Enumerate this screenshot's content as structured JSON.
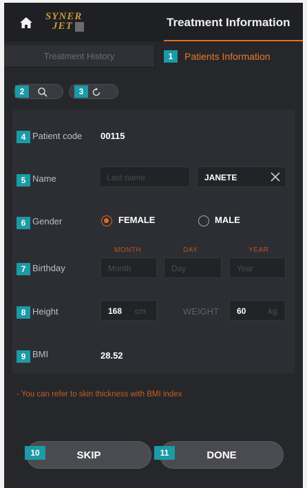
{
  "header": {
    "logo_line1": "SYNER",
    "logo_line2": "JET",
    "title": "Treatment Information",
    "home_icon": "home-icon"
  },
  "tabs": {
    "history": "Treatment History",
    "patients": "Patients Information",
    "patients_num": "1"
  },
  "toolbar": {
    "search_num": "2",
    "search_icon": "search-icon",
    "refresh_num": "3",
    "refresh_icon": "refresh-icon"
  },
  "form": {
    "patient_code": {
      "num": "4",
      "label": "Patient code",
      "value": "00115"
    },
    "name": {
      "num": "5",
      "label": "Name",
      "last_placeholder": "Last name",
      "first_value": "JANETE",
      "clear_icon": "close-icon"
    },
    "gender": {
      "num": "6",
      "label": "Gender",
      "female": "FEMALE",
      "male": "MALE",
      "selected": "FEMALE"
    },
    "birthday": {
      "num": "7",
      "label": "Birthday",
      "month_label": "MONTH",
      "day_label": "DAY",
      "year_label": "YEAR",
      "month_placeholder": "Month",
      "day_placeholder": "Day",
      "year_placeholder": "Year"
    },
    "height": {
      "num": "8",
      "label": "Height",
      "value": "168",
      "unit": "cm"
    },
    "weight": {
      "label": "WEIGHT",
      "value": "60",
      "unit": "kg"
    },
    "bmi": {
      "num": "9",
      "label": "BMI",
      "value": "28.52"
    }
  },
  "note": "- You can refer to skin thickness with BMI index",
  "buttons": {
    "skip": {
      "num": "10",
      "label": "SKIP"
    },
    "done": {
      "num": "11",
      "label": "DONE"
    }
  },
  "colors": {
    "accent": "#e86e24",
    "badge": "#1c9aa5",
    "background": "#26272b"
  }
}
